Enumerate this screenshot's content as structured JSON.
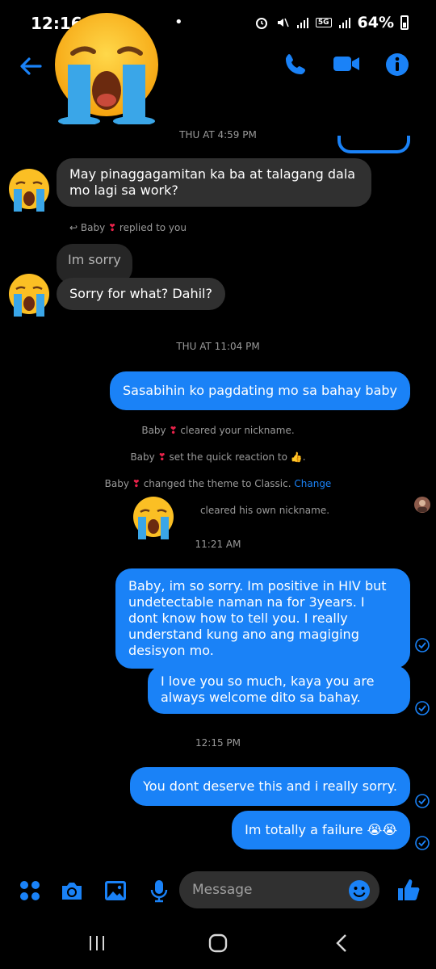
{
  "status": {
    "time": "12:16",
    "network": "5G",
    "battery": "64%"
  },
  "header": {
    "back": "back",
    "call": "voice-call",
    "video": "video-call",
    "info": "info"
  },
  "messages": {
    "ts1": "THU AT 4:59 PM",
    "m1": "May pinaggagamitan ka ba at talagang dala mo lagi sa work?",
    "reply_name": "Baby",
    "reply_text": "replied to you",
    "m2_quoted": "Im sorry",
    "m2": "Sorry for what? Dahil?",
    "ts2": "THU AT 11:04 PM",
    "m3": "Sasabihin ko pagdating mo sa bahay baby",
    "sys1_name": "Baby",
    "sys1_text": "cleared your nickname.",
    "sys2_name": "Baby",
    "sys2_text": "set the quick reaction to",
    "sys2_emoji": "👍",
    "sys3_name": "Baby",
    "sys3_text": "changed the theme to Classic.",
    "sys3_link": "Change",
    "sys4_text": "cleared his own nickname.",
    "ts3": "11:21 AM",
    "m4": "Baby, im so sorry. Im positive in HIV but undetectable naman na for 3years.  I dont know how to tell you. I really understand kung ano ang magiging desisyon mo.",
    "m5": "I love you so much, kaya you are always welcome dito sa bahay.",
    "ts4": "12:15 PM",
    "m6": "You dont deserve this and i really sorry.",
    "m7": "Im totally a failure 😭😭"
  },
  "composer": {
    "placeholder": "Message"
  },
  "colors": {
    "accent": "#1a82f7",
    "incoming": "#303030",
    "heart": "#e8224a"
  }
}
